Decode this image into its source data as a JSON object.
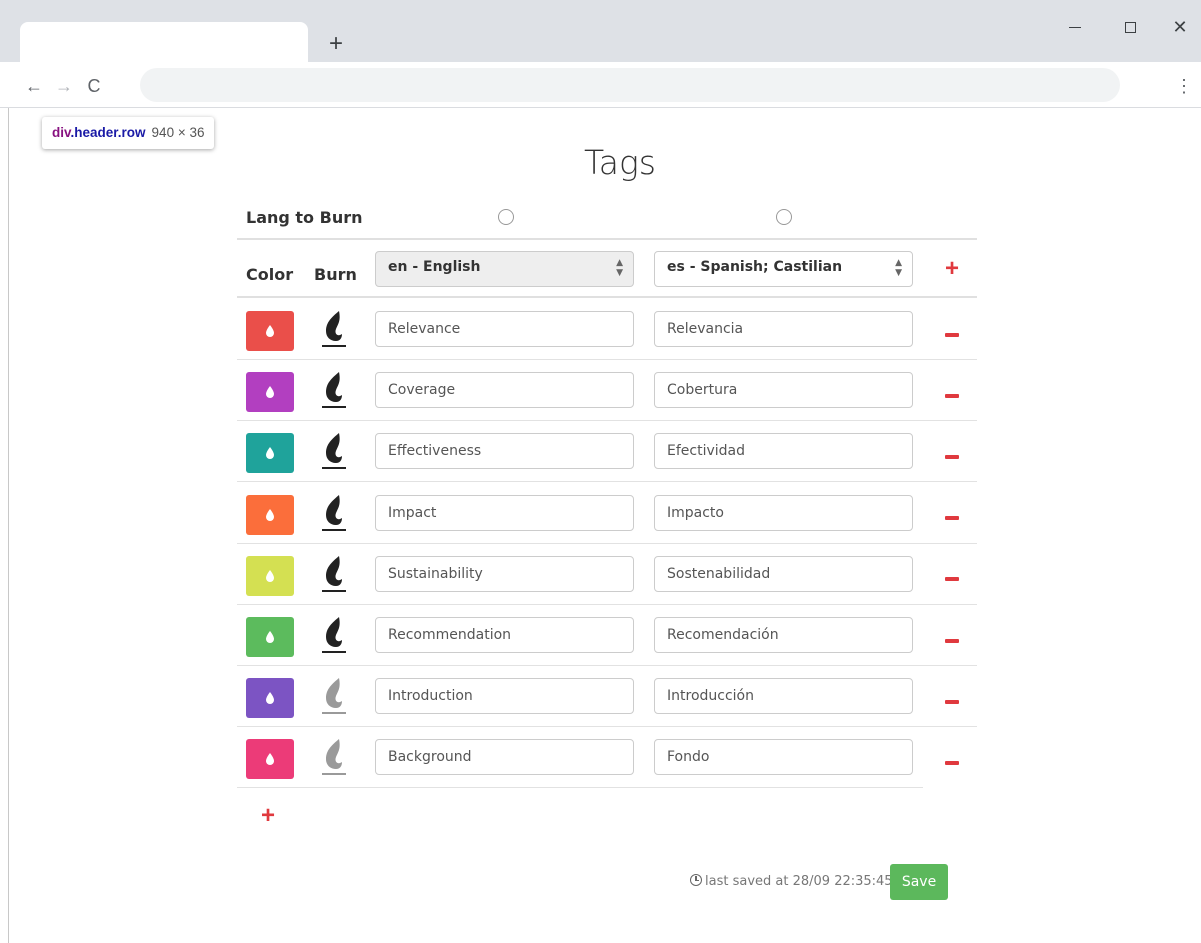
{
  "browser": {
    "new_tab": "+",
    "back": "←",
    "forward": "→",
    "reload": "C",
    "menu": "⋮",
    "close": "✕"
  },
  "devtools_tip": {
    "tag": "div",
    "cls": ".header.row",
    "dims": "940 × 36"
  },
  "page": {
    "title": "Tags"
  },
  "lang_row": {
    "label": "Lang to Burn"
  },
  "header": {
    "color_label": "Color",
    "burn_label": "Burn",
    "lang_en": "en - English",
    "lang_es": "es - Spanish; Castilian",
    "add_symbol": "+"
  },
  "tags": [
    {
      "color": "#ea4f4a",
      "burned": true,
      "en": "Relevance",
      "es": "Relevancia"
    },
    {
      "color": "#b23fc0",
      "burned": true,
      "en": "Coverage",
      "es": "Cobertura"
    },
    {
      "color": "#1fa39b",
      "burned": true,
      "en": "Effectiveness",
      "es": "Efectividad"
    },
    {
      "color": "#fb6e3b",
      "burned": true,
      "en": "Impact",
      "es": "Impacto"
    },
    {
      "color": "#d4e052",
      "burned": true,
      "en": "Sustainability",
      "es": "Sostenabilidad"
    },
    {
      "color": "#5cbb5d",
      "burned": true,
      "en": "Recommendation",
      "es": "Recomendación"
    },
    {
      "color": "#7c54c3",
      "burned": false,
      "en": "Introduction",
      "es": "Introducción"
    },
    {
      "color": "#ec3b78",
      "burned": false,
      "en": "Background",
      "es": "Fondo"
    }
  ],
  "footer": {
    "add_symbol": "+",
    "saved_text": "last saved at 28/09 22:35:45",
    "save_label": "Save"
  }
}
